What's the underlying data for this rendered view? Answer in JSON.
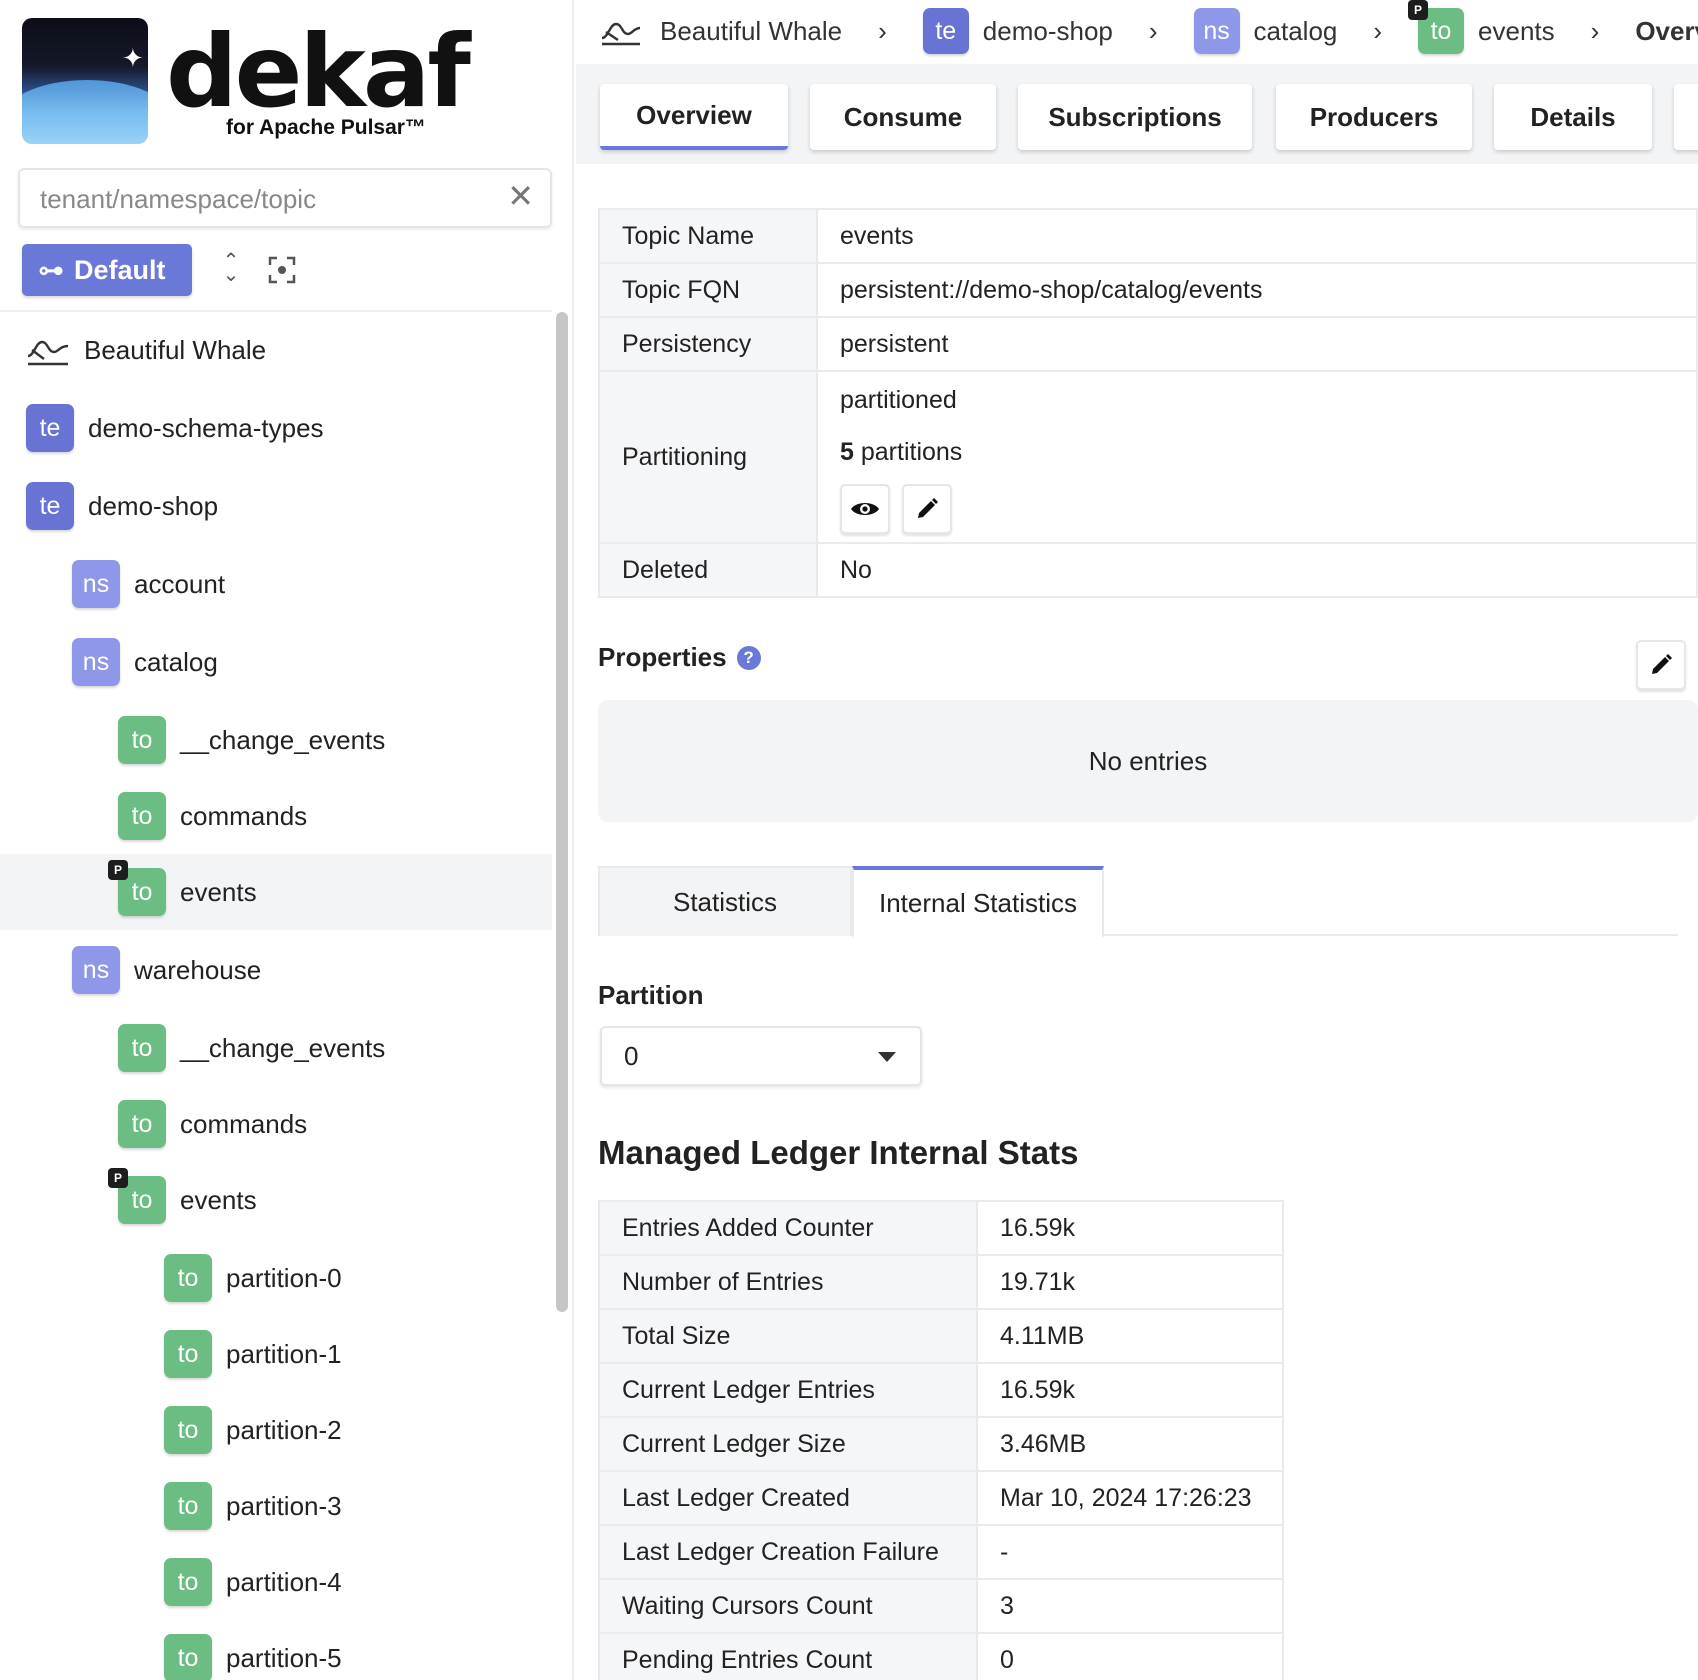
{
  "sidebar": {
    "logo": {
      "word": "dekaf",
      "subtitle": "for Apache Pulsar™"
    },
    "search": {
      "placeholder": "tenant/namespace/topic"
    },
    "default_button": "Default",
    "tree": [
      {
        "kind": "cluster",
        "label": "Beautiful Whale"
      },
      {
        "kind": "te",
        "badge": "te",
        "label": "demo-schema-types"
      },
      {
        "kind": "te",
        "badge": "te",
        "label": "demo-shop"
      },
      {
        "kind": "ns",
        "badge": "ns",
        "label": "account"
      },
      {
        "kind": "ns",
        "badge": "ns",
        "label": "catalog"
      },
      {
        "kind": "to",
        "badge": "to",
        "label": "__change_events"
      },
      {
        "kind": "to",
        "badge": "to",
        "label": "commands"
      },
      {
        "kind": "to",
        "badge": "to",
        "label": "events",
        "partitioned_mark": "P",
        "selected": true
      },
      {
        "kind": "ns",
        "badge": "ns",
        "label": "warehouse"
      },
      {
        "kind": "to",
        "badge": "to",
        "label": "__change_events"
      },
      {
        "kind": "to",
        "badge": "to",
        "label": "commands"
      },
      {
        "kind": "to",
        "badge": "to",
        "label": "events",
        "partitioned_mark": "P"
      },
      {
        "kind": "to",
        "badge": "to",
        "label": "partition-0"
      },
      {
        "kind": "to",
        "badge": "to",
        "label": "partition-1"
      },
      {
        "kind": "to",
        "badge": "to",
        "label": "partition-2"
      },
      {
        "kind": "to",
        "badge": "to",
        "label": "partition-3"
      },
      {
        "kind": "to",
        "badge": "to",
        "label": "partition-4"
      },
      {
        "kind": "to",
        "badge": "to",
        "label": "partition-5"
      }
    ]
  },
  "breadcrumb": {
    "cluster": "Beautiful Whale",
    "tenant_badge": "te",
    "tenant": "demo-shop",
    "namespace_badge": "ns",
    "namespace": "catalog",
    "topic_badge": "to",
    "topic_mark": "P",
    "topic": "events",
    "page": "Overview"
  },
  "tabs": [
    "Overview",
    "Consume",
    "Subscriptions",
    "Producers",
    "Details"
  ],
  "overview": {
    "rows": [
      {
        "key": "Topic Name",
        "value": "events"
      },
      {
        "key": "Topic FQN",
        "value": "persistent://demo-shop/catalog/events"
      },
      {
        "key": "Persistency",
        "value": "persistent"
      }
    ],
    "partitioning": {
      "key": "Partitioning",
      "type": "partitioned",
      "count": "5",
      "count_label": "partitions"
    },
    "deleted": {
      "key": "Deleted",
      "value": "No"
    }
  },
  "properties": {
    "title": "Properties",
    "help": "?",
    "empty": "No entries"
  },
  "stats_tabs": {
    "statistics": "Statistics",
    "internal": "Internal Statistics"
  },
  "partition": {
    "label": "Partition",
    "selected": "0"
  },
  "managed_ledger": {
    "title": "Managed Ledger Internal Stats",
    "rows": [
      {
        "key": "Entries Added Counter",
        "value": "16.59k"
      },
      {
        "key": "Number of Entries",
        "value": "19.71k"
      },
      {
        "key": "Total Size",
        "value": "4.11MB"
      },
      {
        "key": "Current Ledger Entries",
        "value": "16.59k"
      },
      {
        "key": "Current Ledger Size",
        "value": "3.46MB"
      },
      {
        "key": "Last Ledger Created",
        "value": "Mar 10, 2024 17:26:23"
      },
      {
        "key": "Last Ledger Creation Failure",
        "value": "-"
      },
      {
        "key": "Waiting Cursors Count",
        "value": "3"
      },
      {
        "key": "Pending Entries Count",
        "value": "0"
      }
    ]
  },
  "colors": {
    "accent": "#6a79d8",
    "tenant": "#6873d4",
    "namespace": "#8f97e8",
    "topic": "#6cbd84"
  }
}
